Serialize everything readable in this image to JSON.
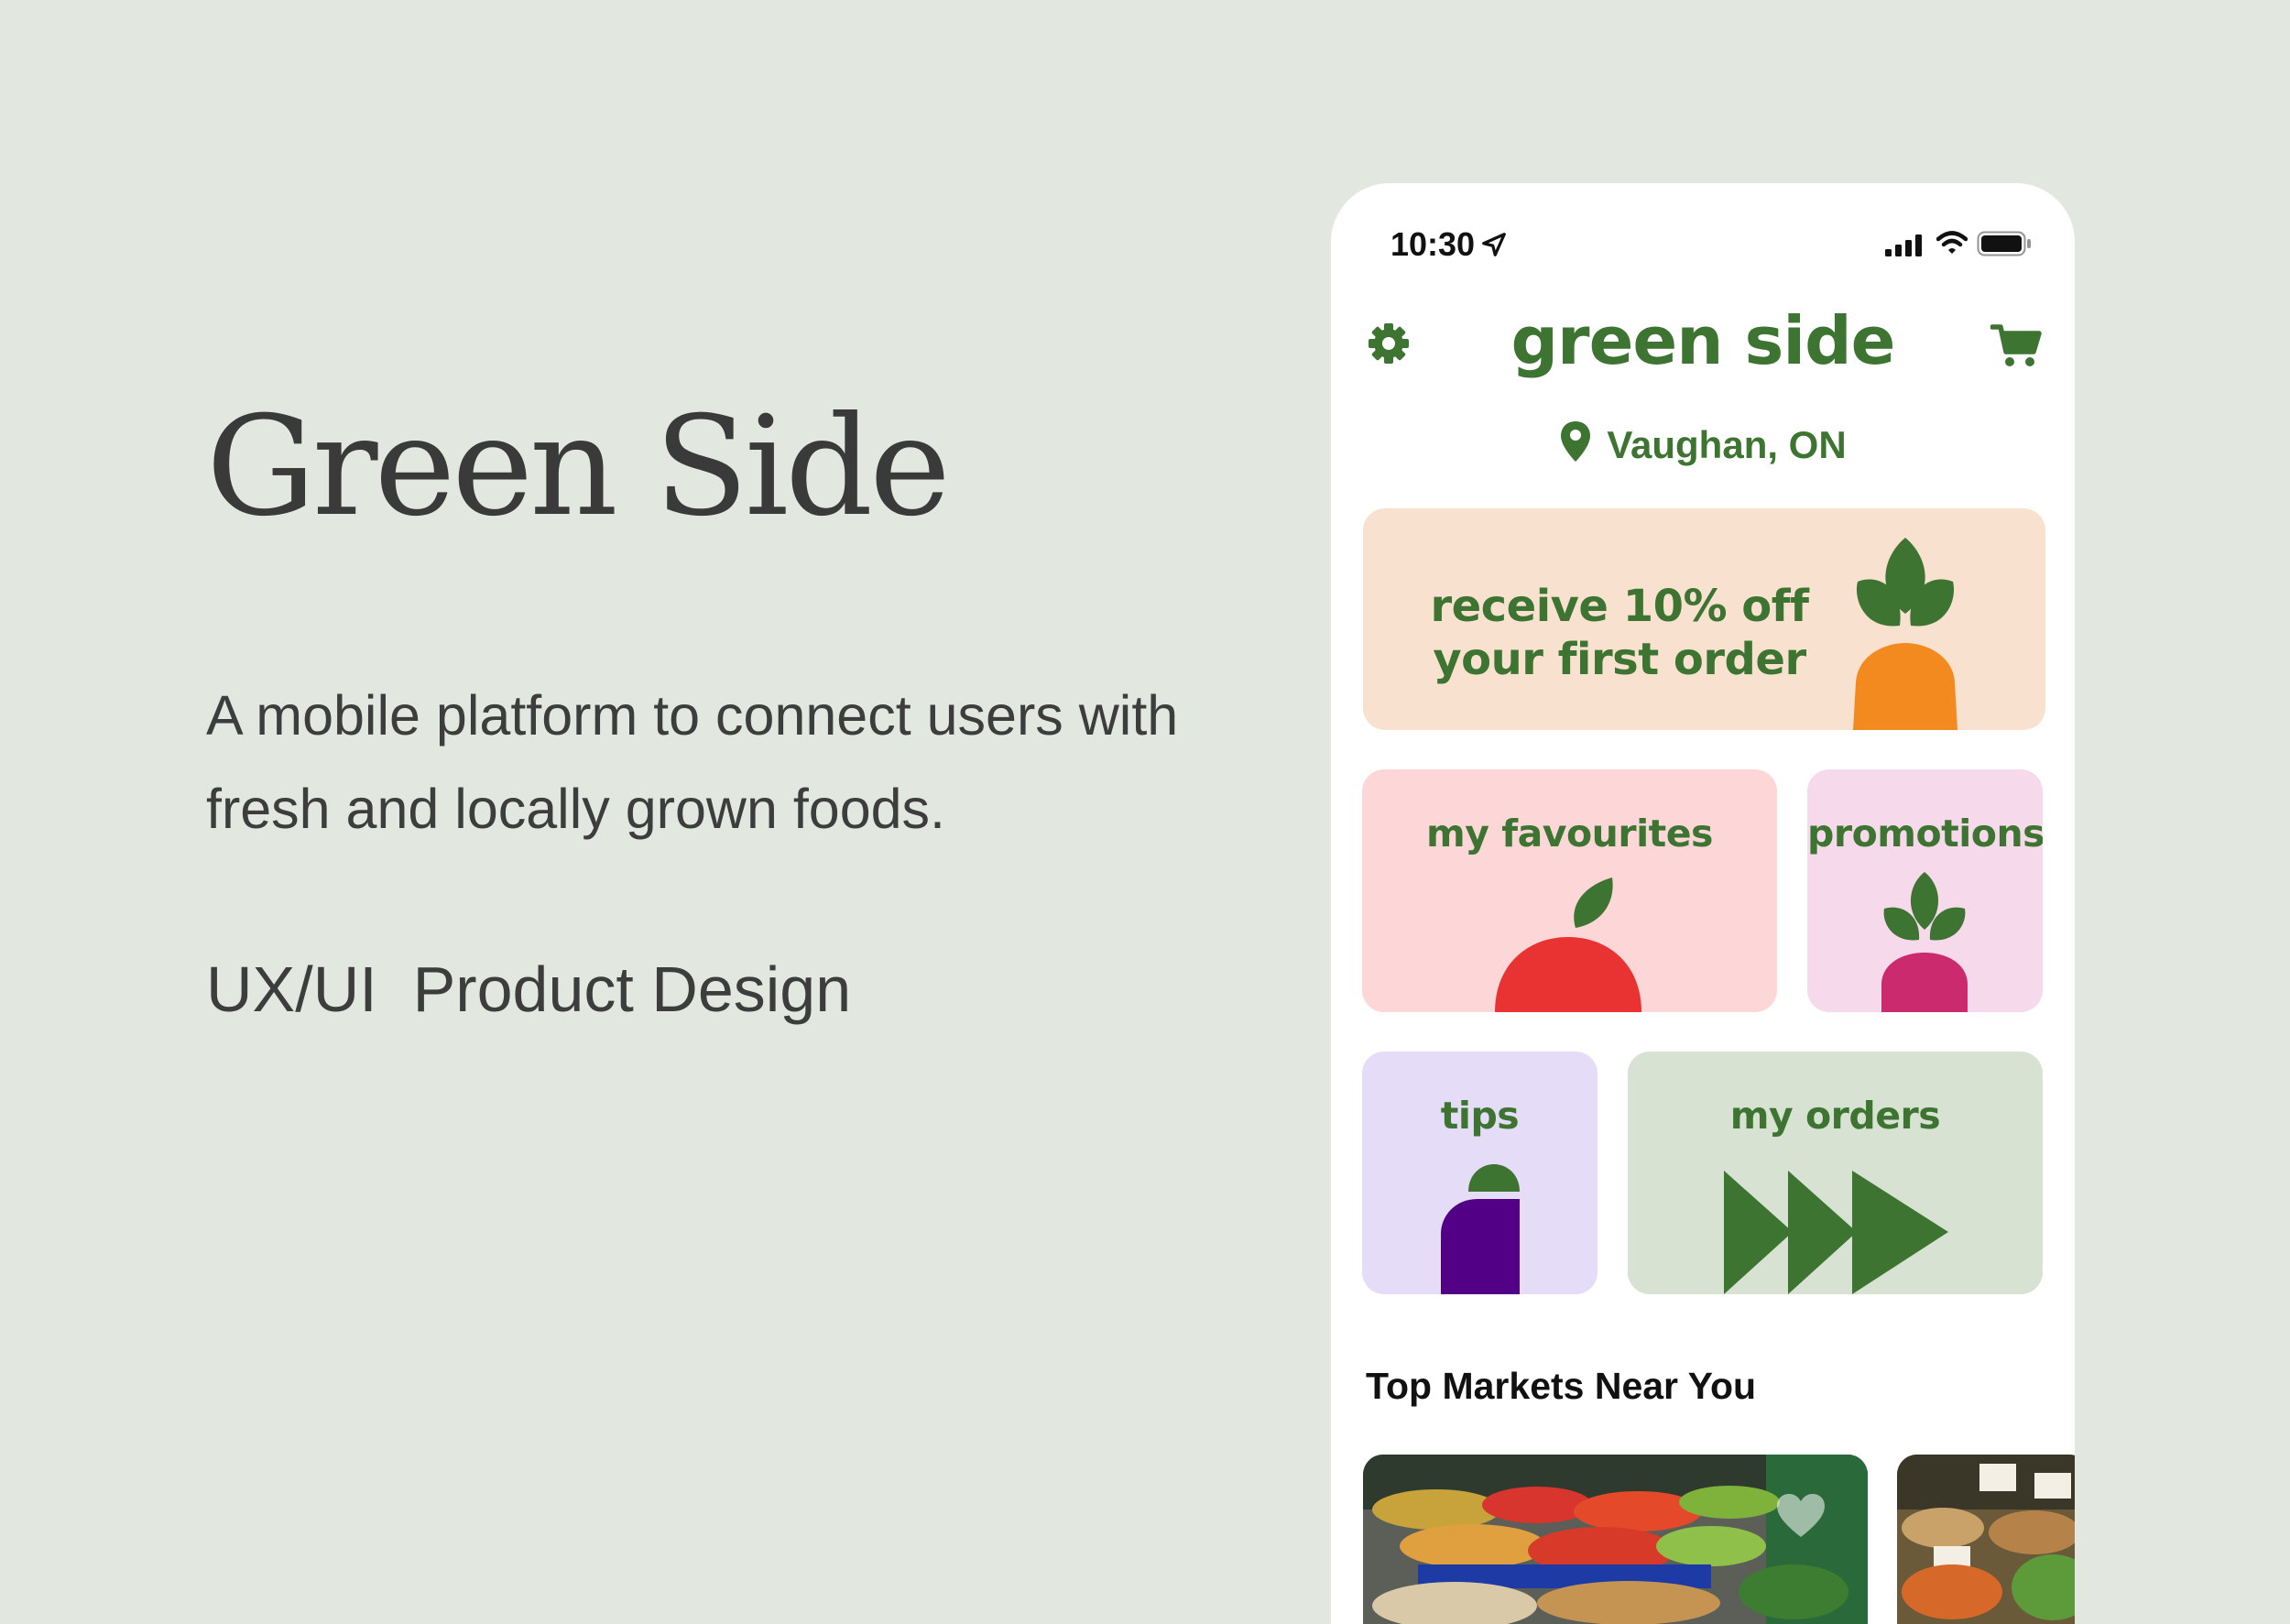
{
  "pitch": {
    "title": "Green Side",
    "description": "A mobile platform to connect users with fresh and locally grown foods.",
    "tag": "UX/UI  Product Design"
  },
  "status_bar": {
    "time": "10:30",
    "icons": [
      "location-arrow-icon",
      "signal-icon",
      "wifi-icon",
      "battery-icon"
    ]
  },
  "header": {
    "brand": "green side",
    "settings_icon": "gear-icon",
    "cart_icon": "cart-icon",
    "location": "Vaughan, ON"
  },
  "promo_banner": {
    "line1": "receive 10% off",
    "line2": "your first order",
    "illustration": "carrot-icon"
  },
  "tiles": {
    "favourites": "my favourites",
    "promotions": "promotions",
    "tips": "tips",
    "orders": "my orders"
  },
  "markets": {
    "title": "Top Markets Near You"
  },
  "colors": {
    "brand_green": "#3e7431",
    "background": "#e2e8e0",
    "promo_bg": "#f9e1cf",
    "favourites_bg": "#fdd7d7",
    "promotions_bg": "#f7d9ec",
    "tips_bg": "#e5dcf7",
    "orders_bg": "#d7e2d2"
  }
}
